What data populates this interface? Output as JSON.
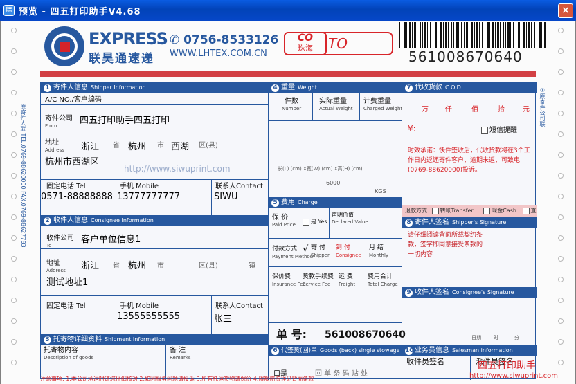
{
  "window": {
    "title": "预览 - 四五打印助手V4.68",
    "app_icon": "暗",
    "close_label": "×"
  },
  "header": {
    "brand_en": "EXPRESS",
    "brand_cn": "联昊通速递",
    "phone": "0756-8533126",
    "website": "WWW.LHTEX.COM.CN",
    "stamp_line1": "CO",
    "stamp_line2": "珠海",
    "to_label": "TO",
    "tracking_number": "561008670640"
  },
  "sender": {
    "header_cn": "寄件人信息",
    "header_en": "Shipper Information",
    "num": "1",
    "account_label": "A/C NO./客户编码",
    "company_label": "寄件公司",
    "company_label_en": "From",
    "company_value": "四五打印助手四五打印",
    "address_label": "地址",
    "address_label_en": "Address",
    "province": "浙江",
    "province_unit": "省",
    "city": "杭州",
    "city_unit": "市",
    "district": "西湖",
    "district_unit": "区(县)",
    "address_detail": "杭州市西湖区",
    "phone_label": "固定电话 Tel",
    "phone_value": "0571-88888888",
    "mobile_label": "手机 Mobile",
    "mobile_value": "13777777777",
    "contact_label": "联系人Contact",
    "contact_value": "SIWU"
  },
  "receiver": {
    "header_cn": "收件人信息",
    "header_en": "Consignee Information",
    "num": "2",
    "company_label": "收件公司",
    "company_label_en": "To",
    "company_value": "客户单位信息1",
    "address_label": "地址",
    "address_label_en": "Address",
    "province": "浙江",
    "province_unit": "省",
    "city": "杭州",
    "city_unit": "市",
    "district_unit": "区(县)",
    "town_unit": "镇",
    "address_detail": "测试地址1",
    "phone_label": "固定电话 Tel",
    "mobile_label": "手机 Mobile",
    "mobile_value": "13555555555",
    "contact_label": "联系人Contact",
    "contact_value": "张三"
  },
  "shipment": {
    "header_cn": "托寄物详细资料",
    "header_en": "Shipment Information",
    "num": "3",
    "content_label": "托寄物内容",
    "content_label_en": "Description of goods",
    "remarks_label": "备 注",
    "remarks_label_en": "Remarks"
  },
  "weight": {
    "header_cn": "重量",
    "header_en": "Weight",
    "num": "4",
    "pieces_label": "件数",
    "pieces_en": "Number",
    "actual_label": "实际重量",
    "actual_en": "Actual Weight",
    "charged_label": "计费重量",
    "charged_en": "Charged Weight",
    "size_label": "长(L)   (cm) X宽(W)   (cm) X高(H)   (cm)",
    "divisor": "6000",
    "kgs": "KGS"
  },
  "charge": {
    "header_cn": "费用",
    "header_en": "Charge",
    "num": "5",
    "insure_label": "保 价",
    "insure_en": "Paid Price",
    "yes_label": "是 Yes",
    "declared_label": "声明价值",
    "declared_en": "Declared Value",
    "payment_label": "付款方式",
    "payment_en": "Payment Method",
    "check_mark": "√",
    "shipper_pay": "寄 付",
    "shipper_pay_en": "Shipper",
    "consignee_pay": "到 付",
    "consignee_pay_en": "Consignee",
    "monthly_pay": "月 结",
    "monthly_en": "Monthly",
    "insure_fee": "保价费",
    "insure_fee_en": "Insurance Fee",
    "cargo_fee": "货款手续费",
    "cargo_fee_en": "Service Fee",
    "freight": "运 费",
    "freight_en": "Freight",
    "total": "费用合计",
    "total_en": "Total Charge",
    "order_label": "单 号:",
    "order_value": "561008670640"
  },
  "receipt": {
    "header_cn": "代签货(回)单",
    "header_en": "Goods (back) single stowage",
    "num": "6",
    "yes_label": "口是",
    "note": "回 单 条 码 贴 处"
  },
  "cod": {
    "header_cn": "代收货款",
    "header_en": "C.O.D",
    "num": "7",
    "units": [
      "万",
      "仟",
      "佰",
      "拾",
      "元"
    ],
    "currency": "¥:",
    "sms_label": "短信提醒",
    "notice": "时效承诺：快件签收后，代收货款将在3个工作日内返还寄件客户，逾期未返，可致电(0769-88620000)投诉。",
    "refund_label": "退款方式",
    "bank_label": "转帐Transfer",
    "cash_label": "现金Cash",
    "other_label": "直返"
  },
  "shipper_sign": {
    "header_cn": "寄件人签名",
    "header_en": "Shipper's Signature",
    "num": "8",
    "text": "请仔细阅读背面所载契约条款，签字即同意接受条款的一切内容"
  },
  "consignee_sign": {
    "header_cn": "收件人签名",
    "header_en": "Consignee's Signature",
    "num": "9",
    "date_label": "日期",
    "hour_label": "时",
    "min_label": "分"
  },
  "salesman": {
    "header_cn": "业务员信息",
    "header_en": "Salesman information",
    "num": "10",
    "collect_label": "收件员签名",
    "deliver_label": "派件员签名"
  },
  "footer": {
    "note": "注意事项: 1.本公司承运时请您仔细核对 2.如因服务问题请投诉 3.所有托运货物请保价 4.限额赔偿详见背面条款",
    "watermark": "四五打印助手",
    "watermark_url": "http://www.siwuprint.com",
    "side_left": "原寄件人联 TEL:0769-88620000 FAX:0769-88627783",
    "side_right": "①原寄件公司联"
  },
  "bg_watermark": "http://www.siwuprint.com"
}
